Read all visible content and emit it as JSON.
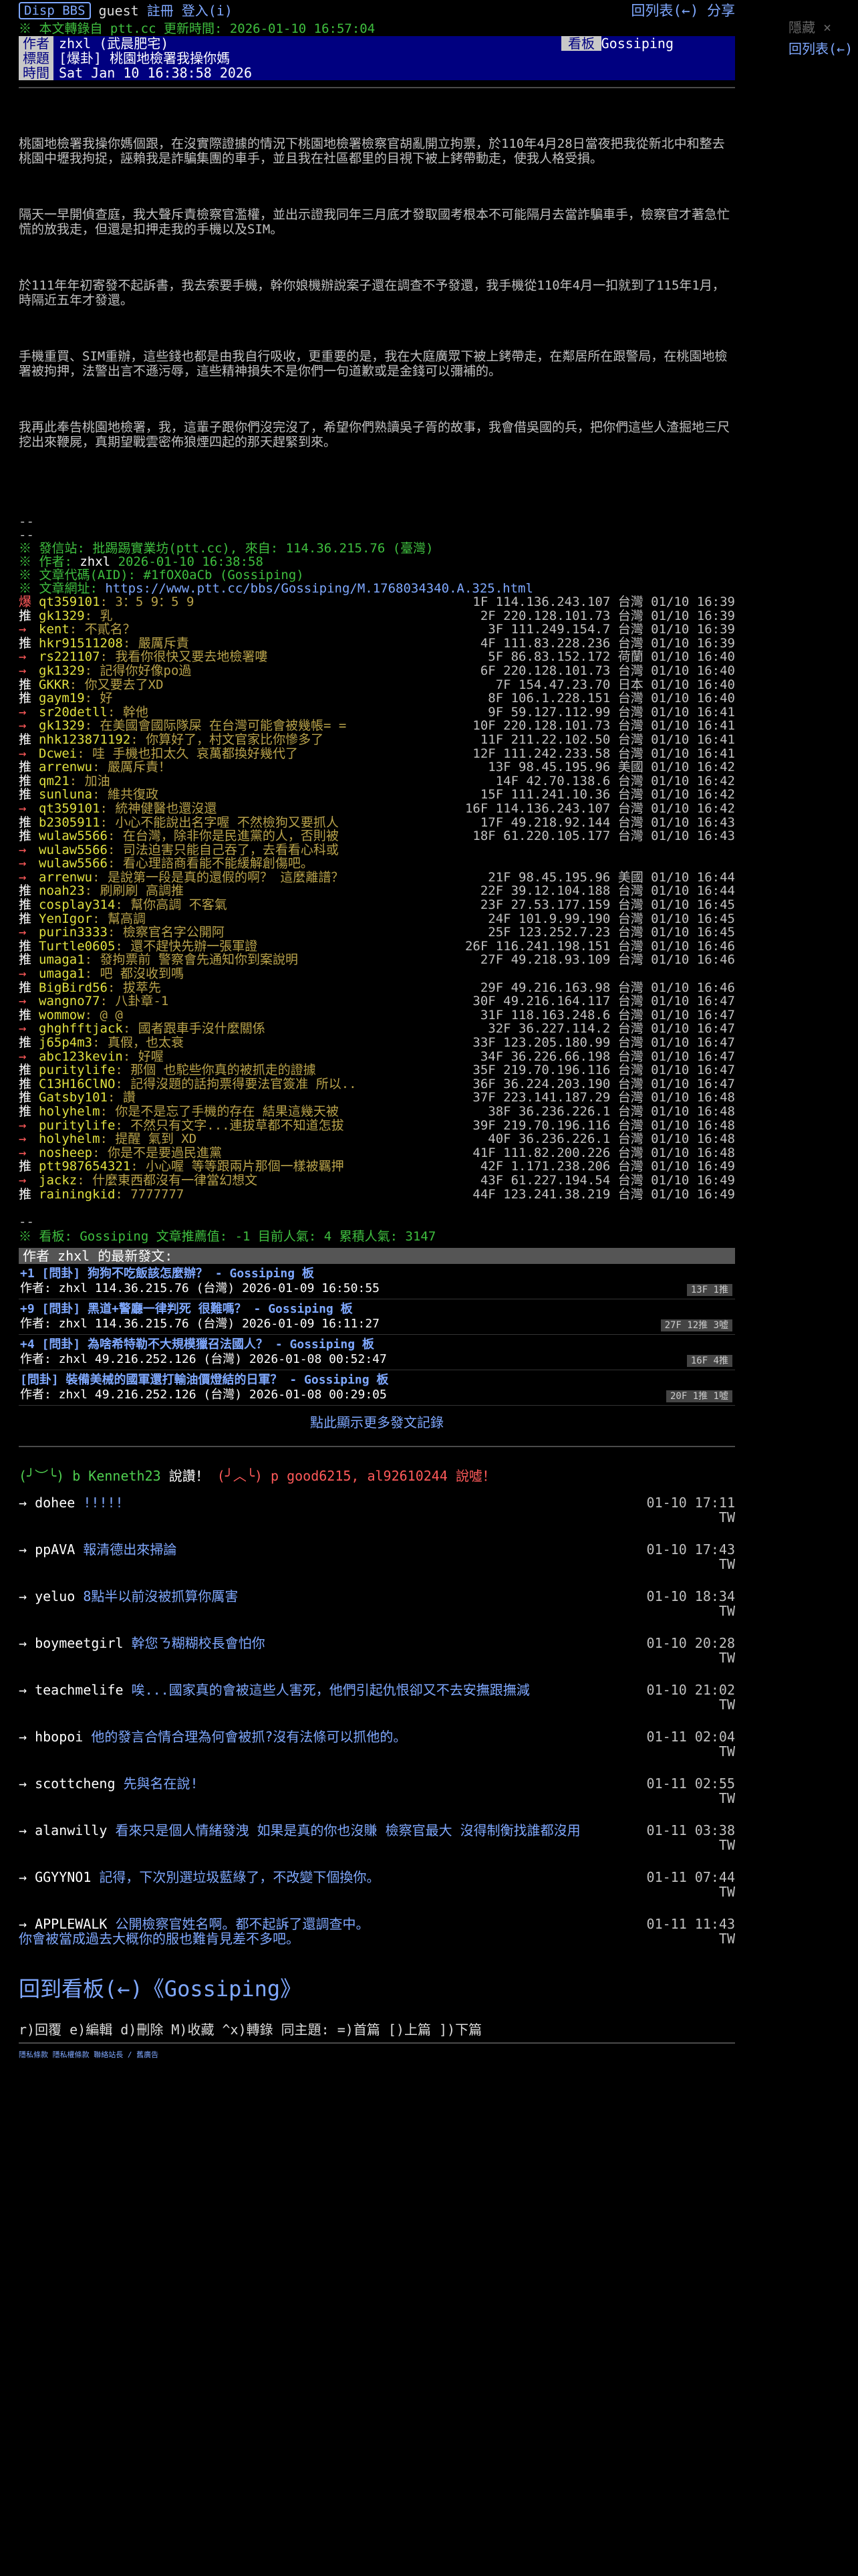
{
  "topbar": {
    "logo": "Disp BBS",
    "guest": "guest",
    "register": "註冊",
    "login": "登入(i)",
    "back": "回列表(←)",
    "share": "分享"
  },
  "sidebar": {
    "hide": "隱藏 ×",
    "back": "回列表(←)"
  },
  "status_line": "※ 本文轉錄自 ptt.cc 更新時間: 2026-01-10 16:57:04",
  "header": {
    "author_tag": "作者",
    "author": "zhxl (武晨肥宅)",
    "title_tag": "標題",
    "title": "[爆卦] 桃園地檢署我操你媽",
    "time_tag": "時間",
    "time": "Sat Jan 10 16:38:58 2026",
    "board_tag": "看板",
    "board": "Gossiping"
  },
  "content": [
    "桃園地檢署我操你媽個跟，在沒實際證據的情況下桃園地檢署檢察官胡亂開立拘票，於110年4月28日當夜把我從新北中和整去桃園中壢我拘捉，誣賴我是詐騙集團的車手，並且我在社區都里的目視下被上銬帶動走，使我人格受損。",
    "隔天一早開偵查庭，我大聲斥責檢察官濫權，並出示證我同年三月底才發取國考根本不可能隔月去當詐騙車手，檢察官才著急忙慌的放我走，但還是扣押走我的手機以及SIM。",
    "於111年年初寄發不起訴書，我去索要手機，幹你娘機辦說案子還在調查不予發還，我手機從110年4月一扣就到了115年1月，時隔近五年才發還。",
    "手機重買、SIM重辦，這些錢也都是由我自行吸收，更重要的是，我在大庭廣眾下被上銬帶走，在鄰居所在跟警局，在桃園地檢署被拘押，法警出言不遜污辱，這些精神損失不是你們一句道歉或是金錢可以彌補的。",
    "我再此奉告桃園地檢署，我，這輩子跟你們沒完沒了，希望你們熟讀吳子胥的故事，我會借吳國的兵，把你們這些人渣掘地三尺挖出來鞭屍，真期望戰雲密佈狼煙四起的那天趕緊到來。"
  ],
  "meta": {
    "dash1": "--",
    "dash2": "--",
    "origin_label": "※ 發信站: 批踢踢實業坊(ptt.cc), 來自: 114.36.215.76 (臺灣)",
    "author_label": "※ 作者:",
    "author_val": "zhxl",
    "author_time": "2026-01-10 16:38:58",
    "aid_label": "※ 文章代碼(AID): #1fOX0aCb (Gossiping)",
    "url_label": "※ 文章網址:",
    "url": "https://www.ptt.cc/bbs/Gossiping/M.1768034340.A.325.html"
  },
  "pushes": [
    {
      "tag": "爆",
      "user": "qt359101",
      "text": "3：5 9：5 9",
      "ip": "1F 114.136.243.107 台灣 01/10 16:39"
    },
    {
      "tag": "推",
      "user": "gk1329",
      "text": "乳",
      "ip": "2F 220.128.101.73 台灣 01/10 16:39"
    },
    {
      "tag": "→",
      "user": "kent",
      "text": "不貳名？",
      "ip": "3F 111.249.154.7 台灣 01/10 16:39"
    },
    {
      "tag": "推",
      "user": "hkr91511208",
      "text": "嚴厲斥責",
      "ip": "4F 111.83.228.236 台灣 01/10 16:39"
    },
    {
      "tag": "→",
      "user": "rs221107",
      "text": "我看你很快又要去地檢署嘍",
      "ip": "5F 86.83.152.172 荷蘭 01/10 16:40"
    },
    {
      "tag": "→",
      "user": "gk1329",
      "text": "記得你好像po過",
      "ip": "6F 220.128.101.73 台灣 01/10 16:40"
    },
    {
      "tag": "推",
      "user": "GKKR",
      "text": "你又要去了XD",
      "ip": "7F 154.47.23.70 日本 01/10 16:40"
    },
    {
      "tag": "推",
      "user": "gaym19",
      "text": "好",
      "ip": "8F 106.1.228.151 台灣 01/10 16:40"
    },
    {
      "tag": "→",
      "user": "sr20detll",
      "text": "幹他",
      "ip": "9F 59.127.112.99 台灣 01/10 16:41"
    },
    {
      "tag": "→",
      "user": "gk1329",
      "text": "在美國會國际隊屎 在台灣可能會被幾帳= =",
      "ip": "10F 220.128.101.73 台灣 01/10 16:41"
    },
    {
      "tag": "推",
      "user": "nhk123871192",
      "text": "你算好了，村文官家比你慘多了",
      "ip": "11F 211.22.102.50 台灣 01/10 16:41"
    },
    {
      "tag": "→",
      "user": "Dcwei",
      "text": "哇 手機也扣太久 哀萬都換好幾代了",
      "ip": "12F 111.242.233.58 台灣 01/10 16:41"
    },
    {
      "tag": "推",
      "user": "arrenwu",
      "text": "嚴厲斥責！",
      "ip": "13F 98.45.195.96 美國 01/10 16:42"
    },
    {
      "tag": "推",
      "user": "qm21",
      "text": "加油",
      "ip": "14F 42.70.138.6 台灣 01/10 16:42"
    },
    {
      "tag": "推",
      "user": "sunluna",
      "text": "維共復政",
      "ip": "15F 111.241.10.36 台灣 01/10 16:42"
    },
    {
      "tag": "→",
      "user": "qt359101",
      "text": "統神健醫也還沒還",
      "ip": "16F 114.136.243.107 台灣 01/10 16:42"
    },
    {
      "tag": "推",
      "user": "b2305911",
      "text": "小心不能說出名字喔 不然檢狗又要抓人",
      "ip": "17F 49.218.92.144 台灣 01/10 16:43"
    },
    {
      "tag": "推",
      "user": "wulaw5566",
      "text": "在台灣，除非你是民進黨的人，否則被",
      "ip": "18F 61.220.105.177 台灣 01/10 16:43"
    },
    {
      "tag": "→",
      "user": "wulaw5566",
      "text": "司法迫害只能自己吞了，去看看心科或",
      "ip": ""
    },
    {
      "tag": "→",
      "user": "wulaw5566",
      "text": "看心理諮商看能不能緩解創傷吧。",
      "ip": ""
    },
    {
      "tag": "→",
      "user": "arrenwu",
      "text": "是說第一段是真的還假的啊？ 這麼離譜？",
      "ip": "21F 98.45.195.96 美國 01/10 16:44"
    },
    {
      "tag": "推",
      "user": "noah23",
      "text": "刷刷刷 高調推",
      "ip": "22F 39.12.104.188 台灣 01/10 16:44"
    },
    {
      "tag": "推",
      "user": "cosplay314",
      "text": "幫你高調 不客氣",
      "ip": "23F 27.53.177.159 台灣 01/10 16:45"
    },
    {
      "tag": "推",
      "user": "YenIgor",
      "text": "幫高調",
      "ip": "24F 101.9.99.190 台灣 01/10 16:45"
    },
    {
      "tag": "→",
      "user": "purin3333",
      "text": "檢察官名字公開阿",
      "ip": "25F 123.252.7.23 台灣 01/10 16:45"
    },
    {
      "tag": "推",
      "user": "Turtle0605",
      "text": "還不趕快先辦一張軍證",
      "ip": "26F 116.241.198.151 台灣 01/10 16:46"
    },
    {
      "tag": "推",
      "user": "umaga1",
      "text": "發拘票前 警察會先通知你到案說明",
      "ip": "27F 49.218.93.109 台灣 01/10 16:46"
    },
    {
      "tag": "→",
      "user": "umaga1",
      "text": "吧 都沒收到嗎",
      "ip": ""
    },
    {
      "tag": "推",
      "user": "BigBird56",
      "text": "拔萃先",
      "ip": "29F 49.216.163.98 台灣 01/10 16:46"
    },
    {
      "tag": "→",
      "user": "wangno77",
      "text": "八卦章-1",
      "ip": "30F 49.216.164.117 台灣 01/10 16:47"
    },
    {
      "tag": "推",
      "user": "wommow",
      "text": "@_@",
      "ip": "31F 118.163.248.6 台灣 01/10 16:47"
    },
    {
      "tag": "→",
      "user": "ghghfftjack",
      "text": "國者跟車手沒什麼關係",
      "ip": "32F 36.227.114.2 台灣 01/10 16:47"
    },
    {
      "tag": "推",
      "user": "j65p4m3",
      "text": "真假，也太衰",
      "ip": "33F 123.205.180.99 台灣 01/10 16:47"
    },
    {
      "tag": "→",
      "user": "abc123kevin",
      "text": "好喔",
      "ip": "34F 36.226.66.198 台灣 01/10 16:47"
    },
    {
      "tag": "推",
      "user": "puritylife",
      "text": "那個 也駝些你真的被抓走的證據",
      "ip": "35F 219.70.196.116 台灣 01/10 16:47"
    },
    {
      "tag": "推",
      "user": "C13H16ClNO",
      "text": "記得沒題的話拘票得要法官簽准 所以..",
      "ip": "36F 36.224.203.190 台灣 01/10 16:47"
    },
    {
      "tag": "推",
      "user": "Gatsby101",
      "text": "讚",
      "ip": "37F 223.141.187.29 台灣 01/10 16:48"
    },
    {
      "tag": "推",
      "user": "holyhelm",
      "text": "你是不是忘了手機的存在 結果這幾天被",
      "ip": "38F 36.236.226.1 台灣 01/10 16:48"
    },
    {
      "tag": "→",
      "user": "puritylife",
      "text": "不然只有文字...連拔草都不知道怎拔",
      "ip": "39F 219.70.196.116 台灣 01/10 16:48"
    },
    {
      "tag": "→",
      "user": "holyhelm",
      "text": "提醒 氣到 XD",
      "ip": "40F 36.236.226.1 台灣 01/10 16:48"
    },
    {
      "tag": "→",
      "user": "nosheep",
      "text": "你是不是要過民進黨",
      "ip": "41F 111.82.200.226 台灣 01/10 16:48"
    },
    {
      "tag": "推",
      "user": "ptt987654321",
      "text": "小心喔 等等跟兩片那個一樣被羈押",
      "ip": "42F 1.171.238.206 台灣 01/10 16:49"
    },
    {
      "tag": "→",
      "user": "jackz",
      "text": "什麼東西都沒有一律當幻想文",
      "ip": "43F 61.227.194.54 台灣 01/10 16:49"
    },
    {
      "tag": "推",
      "user": "rainingkid",
      "text": "7777777",
      "ip": "44F 123.241.38.219 台灣 01/10 16:49"
    }
  ],
  "stats": {
    "dash": "--",
    "line": "※ 看板: Gossiping 文章推薦值: -1 目前人氣: 4 累積人氣: 3147"
  },
  "related": {
    "header": "作者 zhxl 的最新發文:",
    "items": [
      {
        "title": "+1 [問卦] 狗狗不吃飯該怎麼辦？ - Gossiping 板",
        "meta": "作者: zhxl 114.36.215.76 (台灣) 2026-01-09 16:50:55",
        "badge": "13F 1推"
      },
      {
        "title": "+9 [問卦] 黑道+警廳一律判死 很難嗎？ - Gossiping 板",
        "meta": "作者: zhxl 114.36.215.76 (台灣) 2026-01-09 16:11:27",
        "badge": "27F 12推 3噓"
      },
      {
        "title": "+4 [問卦] 為啥希特勒不大規模獵召法國人？ - Gossiping 板",
        "meta": "作者: zhxl 49.216.252.126 (台灣) 2026-01-08 00:52:47",
        "badge": "16F 4推"
      },
      {
        "title": "[問卦] 裝備美械的國軍還打輸油價燈結的日軍？ - Gossiping 板",
        "meta": "作者: zhxl 49.216.252.126 (台灣) 2026-01-08 00:29:05",
        "badge": "20F 1推 1噓"
      }
    ],
    "more": "點此顯示更多發文記錄"
  },
  "comments_header": {
    "face1": "(╯︶╰)",
    "user1": "b Kenneth23",
    "said1": "說讚！",
    "face2": "(╯︿╰)",
    "user2": "p good6215, al92610244",
    "said2": "說噓！"
  },
  "comments": [
    {
      "user": "dohee",
      "text": "!!!!!",
      "time": "01-10 17:11",
      "loc": "TW"
    },
    {
      "user": "ppAVA",
      "text": "報清德出來掃論",
      "time": "01-10 17:43",
      "loc": "TW"
    },
    {
      "user": "yeluo",
      "text": "8點半以前沒被抓算你厲害",
      "time": "01-10 18:34",
      "loc": "TW"
    },
    {
      "user": "boymeetgirl",
      "text": "幹您ㄋ糊糊校長會怕你",
      "time": "01-10 20:28",
      "loc": "TW"
    },
    {
      "user": "teachmelife",
      "text": "唉...國家真的會被這些人害死，他們引起仇恨卻又不去安撫跟撫減",
      "time": "01-10 21:02",
      "loc": "TW"
    },
    {
      "user": "hbopoi",
      "text": "他的發言合情合理為何會被抓?沒有法條可以抓他的。",
      "time": "01-11 02:04",
      "loc": "TW"
    },
    {
      "user": "scottcheng",
      "text": "先與名在說!",
      "time": "01-11 02:55",
      "loc": "TW"
    },
    {
      "user": "alanwilly",
      "text": "看來只是個人情緒發洩 如果是真的你也沒賺 檢察官最大 沒得制衡找誰都沒用",
      "time": "01-11 03:38",
      "loc": "TW"
    },
    {
      "user": "GGYYNO1",
      "text": "記得，下次別選垃圾藍綠了，不改變下個換你。",
      "time": "01-11 07:44",
      "loc": "TW"
    },
    {
      "user": "APPLEWALK",
      "text": "公開檢察官姓名啊。都不起訴了還調查中。\n你會被當成過去大概你的服也難肯見差不多吧。",
      "time": "01-11 11:43",
      "loc": "TW"
    }
  ],
  "footer": {
    "back_board": "回到看板(←)《Gossiping》",
    "keys": "r)回覆 e)編輯 d)刪除 M)收藏 ^x)轉錄 同主題: =)首篇 [)上篇 ])下篇",
    "small": "隱私條款 隱私權條款 聯絡站長 / 舊廣告"
  }
}
